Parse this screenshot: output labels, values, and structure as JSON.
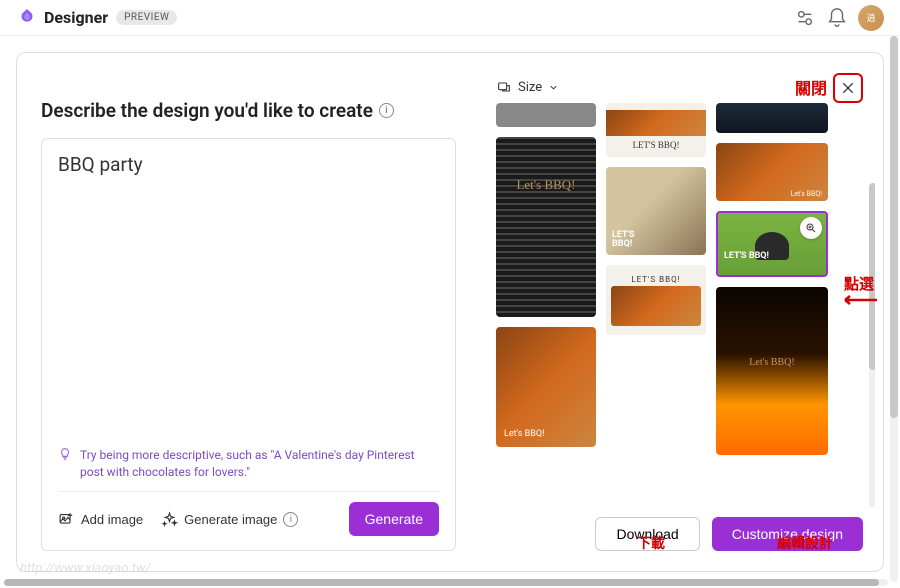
{
  "header": {
    "brand": "Designer",
    "badge": "PREVIEW"
  },
  "left": {
    "title": "Describe the design you'd like to create",
    "prompt_value": "BBQ party",
    "hint": "Try being more descriptive, such as \"A Valentine's day Pinterest post with chocolates for lovers.\"",
    "add_image": "Add image",
    "gen_image": "Generate image",
    "generate": "Generate"
  },
  "right": {
    "size_label": "Size",
    "download": "Download",
    "customize": "Customize design"
  },
  "annotations": {
    "close": "關閉",
    "click": "點選",
    "download": "下載",
    "edit": "編輯設計"
  },
  "gallery": {
    "items": [
      {
        "label": ""
      },
      {
        "label": "Let's BBQ!"
      },
      {
        "label": "LET'S BBQ!"
      },
      {
        "label": "LET'S BBQ!"
      },
      {
        "label": "Let's BBQ!"
      },
      {
        "label": "LET'S BBQ!"
      },
      {
        "label": "LET'S BBQ!"
      },
      {
        "label": "Let's BBQ!"
      },
      {
        "label": "Let's BBQ!"
      }
    ]
  },
  "watermark": "http://www.xiaoyao.tw/"
}
